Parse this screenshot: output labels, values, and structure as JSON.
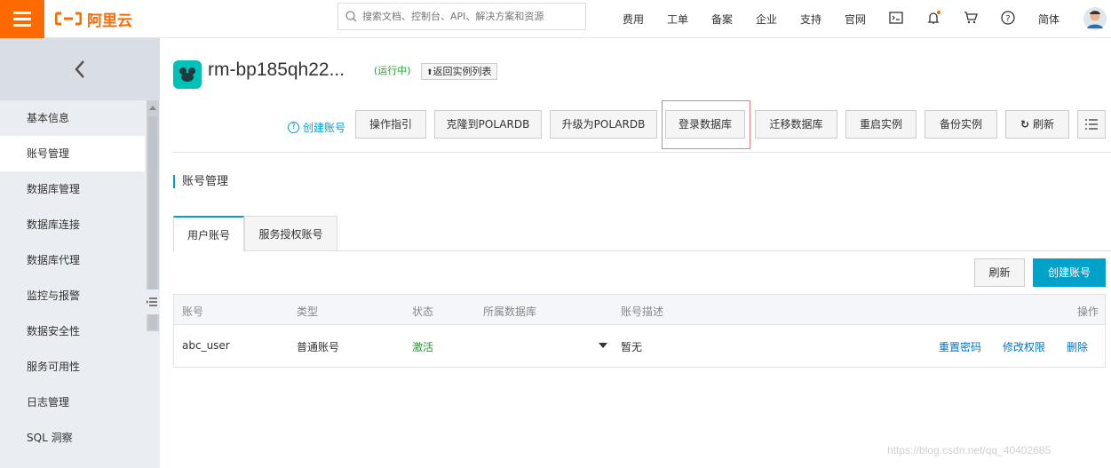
{
  "topbar": {
    "logo_text": "阿里云",
    "search_placeholder": "搜索文档、控制台、API、解决方案和资源",
    "nav": [
      "费用",
      "工单",
      "备案",
      "企业",
      "支持",
      "官网"
    ],
    "lang": "简体",
    "accent": "#ff6a00"
  },
  "sidebar": {
    "items": [
      "基本信息",
      "账号管理",
      "数据库管理",
      "数据库连接",
      "数据库代理",
      "监控与报警",
      "数据安全性",
      "服务可用性",
      "日志管理",
      "SQL 洞察"
    ],
    "active_index": 1
  },
  "instance": {
    "name": "rm-bp185qh22...",
    "status": "(运行中)",
    "back_label": "返回实例列表"
  },
  "toolbar": {
    "create_account_link": "创建账号",
    "buttons": [
      "操作指引",
      "克隆到POLARDB",
      "升级为POLARDB",
      "登录数据库",
      "迁移数据库",
      "重启实例",
      "备份实例",
      "刷新"
    ]
  },
  "section": {
    "title": "账号管理"
  },
  "tabs": [
    "用户账号",
    "服务授权账号"
  ],
  "actions": {
    "refresh": "刷新",
    "create": "创建账号"
  },
  "table": {
    "columns": [
      "账号",
      "类型",
      "状态",
      "所属数据库",
      "账号描述",
      "操作"
    ],
    "rows": [
      {
        "account": "abc_user",
        "type": "普通账号",
        "status": "激活",
        "database": "",
        "description": "暂无",
        "ops": [
          "重置密码",
          "修改权限",
          "删除"
        ]
      }
    ]
  },
  "watermark": "https://blog.csdn.net/qq_40402685",
  "colors": {
    "link": "#0073c7",
    "primary": "#00a2ca",
    "status_active": "#1e9c2f",
    "highlight_box": "#f07a7a"
  }
}
